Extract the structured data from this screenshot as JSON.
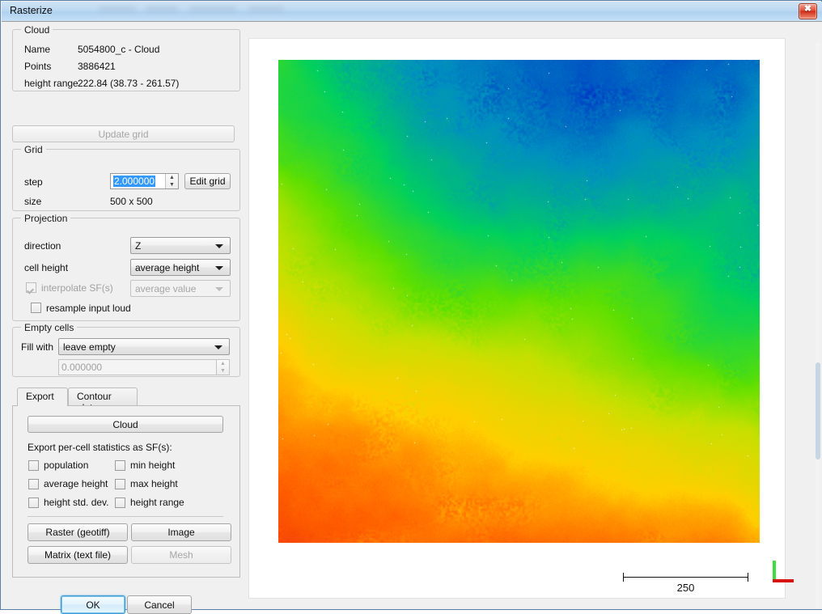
{
  "window": {
    "title": "Rasterize",
    "close_icon": "close-icon",
    "close_glyph": "✖"
  },
  "cloud_group": {
    "title": "Cloud",
    "rows": [
      {
        "label": "Name",
        "value": "5054800_c - Cloud"
      },
      {
        "label": "Points",
        "value": "3886421"
      },
      {
        "label": "height range",
        "value": "222.84 (38.73 - 261.57)"
      }
    ]
  },
  "update_grid": {
    "label": "Update grid",
    "enabled": false
  },
  "grid_group": {
    "title": "Grid",
    "step_label": "step",
    "step_value": "2.000000",
    "edit_grid_label": "Edit grid",
    "size_label": "size",
    "size_value": "500 x 500",
    "spin_up_glyph": "▲",
    "spin_down_glyph": "▼"
  },
  "projection_group": {
    "title": "Projection",
    "direction_label": "direction",
    "direction_value": "Z",
    "cell_height_label": "cell height",
    "cell_height_value": "average height",
    "interpolate_label": "interpolate SF(s)",
    "interpolate_checked": true,
    "interpolate_enabled": false,
    "sf_value": "average value",
    "resample_label": "resample input loud",
    "resample_checked": false
  },
  "empty_cells_group": {
    "title": "Empty cells",
    "fill_with_label": "Fill with",
    "fill_with_value": "leave empty",
    "custom_value": "0.000000"
  },
  "tabs": {
    "items": [
      {
        "label": "Export",
        "active": true
      },
      {
        "label": "Contour plot",
        "active": false
      }
    ],
    "export_pane": {
      "cloud_button": "Cloud",
      "stats_label": "Export per-cell statistics as SF(s):",
      "checkboxes": [
        {
          "label": "population",
          "checked": false
        },
        {
          "label": "min height",
          "checked": false
        },
        {
          "label": "average height",
          "checked": false
        },
        {
          "label": "max height",
          "checked": false
        },
        {
          "label": "height std. dev.",
          "checked": false
        },
        {
          "label": "height range",
          "checked": false
        }
      ],
      "buttons": [
        {
          "label": "Raster (geotiff)",
          "enabled": true
        },
        {
          "label": "Image",
          "enabled": true
        },
        {
          "label": "Matrix (text file)",
          "enabled": true
        },
        {
          "label": "Mesh",
          "enabled": false
        }
      ]
    }
  },
  "dialog_buttons": {
    "ok": "OK",
    "cancel": "Cancel"
  },
  "viewport": {
    "scale_bar_value": "250",
    "axis_gizmo": {
      "y_axis_color": "#3ddd3d",
      "x_axis_color": "#d81111"
    },
    "cloud_render": {
      "description": "point cloud height-colored raster preview",
      "colormap": [
        "#0018c8",
        "#0090c0",
        "#00d060",
        "#60e000",
        "#c8e000",
        "#ffd000",
        "#ff6000",
        "#e81010"
      ],
      "height_min": 38.73,
      "height_max": 261.57
    }
  },
  "colors": {
    "accent_focus": "#3c9bd6",
    "selection": "#3399ff",
    "titlebar_top": "#cfe3f5",
    "titlebar_bottom": "#c6e0f6",
    "close_red": "#d2301b",
    "panel_bg": "#f0f0f0"
  }
}
